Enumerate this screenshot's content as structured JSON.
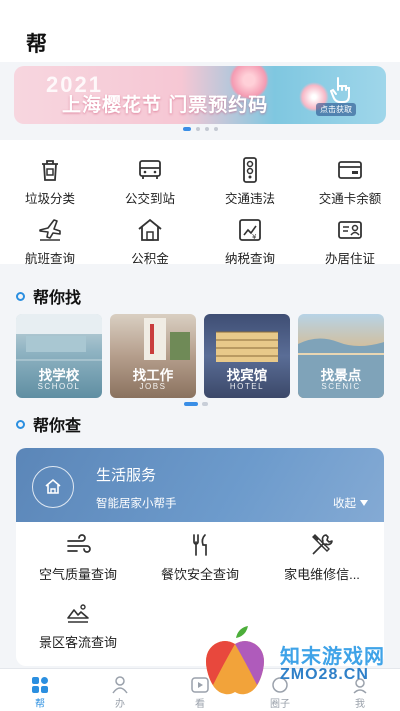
{
  "header": {
    "title": "帮"
  },
  "banner": {
    "year": "2021",
    "headline": "上海樱花节  门票预约码",
    "cta": "点击获取",
    "page_count": 4,
    "active_page": 0
  },
  "services": [
    {
      "label": "垃圾分类",
      "icon": "trash-bin-icon"
    },
    {
      "label": "公交到站",
      "icon": "bus-stop-icon"
    },
    {
      "label": "交通违法",
      "icon": "traffic-light-icon"
    },
    {
      "label": "交通卡余额",
      "icon": "transit-card-icon"
    },
    {
      "label": "航班查询",
      "icon": "airplane-icon"
    },
    {
      "label": "公积金",
      "icon": "house-fund-icon"
    },
    {
      "label": "纳税查询",
      "icon": "tax-chart-icon"
    },
    {
      "label": "办居住证",
      "icon": "id-card-icon"
    }
  ],
  "find_section": {
    "title": "帮你找",
    "cards": [
      {
        "name": "找学校",
        "en": "SCHOOL",
        "color": "#7fa8b8"
      },
      {
        "name": "找工作",
        "en": "JOBS",
        "color": "#b7a89a"
      },
      {
        "name": "找宾馆",
        "en": "HOTEL",
        "color": "#4a5f8a"
      },
      {
        "name": "找景点",
        "en": "SCENIC",
        "color": "#d2a56e"
      }
    ]
  },
  "check_section": {
    "title": "帮你查",
    "panel": {
      "title": "生活服务",
      "subtitle": "智能居家小帮手",
      "collapse_label": "收起",
      "items": [
        {
          "label": "空气质量查询",
          "icon": "wind-icon"
        },
        {
          "label": "餐饮安全查询",
          "icon": "fork-knife-icon"
        },
        {
          "label": "家电维修信...",
          "icon": "tools-icon"
        },
        {
          "label": "景区客流查询",
          "icon": "mountain-icon"
        }
      ]
    }
  },
  "tabbar": [
    {
      "label": "帮",
      "icon": "grid-icon",
      "active": true
    },
    {
      "label": "办",
      "icon": "person-icon",
      "active": false
    },
    {
      "label": "看",
      "icon": "play-icon",
      "active": false
    },
    {
      "label": "圈子",
      "icon": "circle-icon",
      "active": false
    },
    {
      "label": "我",
      "icon": "profile-icon",
      "active": false
    }
  ],
  "watermark": {
    "brand": "知末游戏网",
    "url": "ZMO28.CN"
  },
  "colors": {
    "accent": "#2b8fe0",
    "panel_header": "#6d9bcc"
  }
}
